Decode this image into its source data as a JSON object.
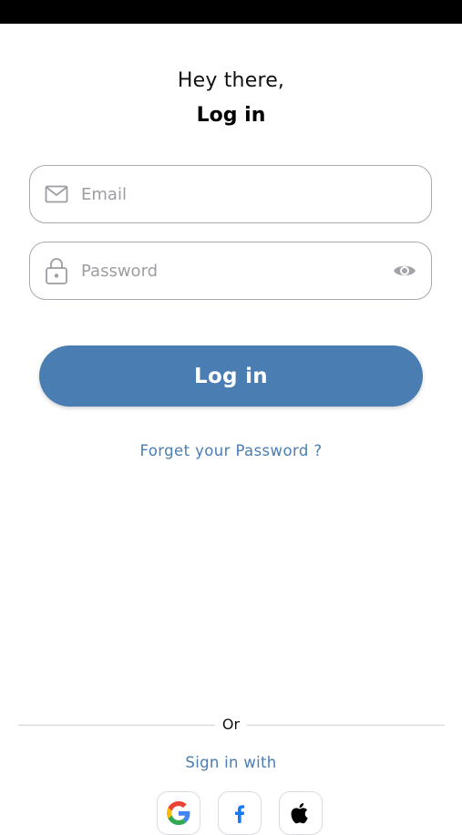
{
  "colors": {
    "accent": "#4a7db1",
    "status_bar": "#000000",
    "field_border": "#a9a9b0",
    "placeholder": "#9d9da3"
  },
  "header": {
    "greeting": "Hey there,",
    "title": "Log in"
  },
  "form": {
    "email": {
      "placeholder": "Email",
      "value": "",
      "icon": "mail-icon"
    },
    "password": {
      "placeholder": "Password",
      "value": "",
      "icon": "lock-icon",
      "toggle_icon": "eye-icon"
    },
    "login_label": "Log in",
    "forgot_label": "Forget your Password ?"
  },
  "social": {
    "divider_text": "Or",
    "signin_label": "Sign in with",
    "providers": [
      {
        "name": "Google",
        "icon": "google-icon"
      },
      {
        "name": "Facebook",
        "icon": "facebook-icon"
      },
      {
        "name": "Apple",
        "icon": "apple-icon"
      }
    ]
  }
}
